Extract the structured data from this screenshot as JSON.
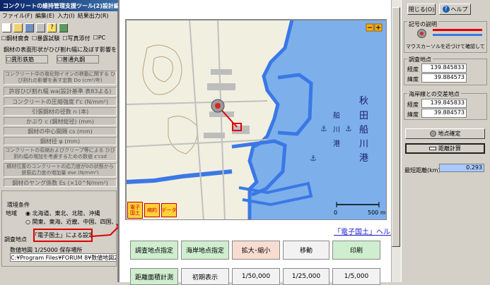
{
  "left": {
    "title": "コンクリートの維持管理支援ツール(2)設計編",
    "menu": [
      "ファイル(F)",
      "編集(E)",
      "入力(I)",
      "結果出力(R)"
    ],
    "toolbar_checks": [
      "鋼材腐食",
      "暴露試験",
      "写真添付",
      "PC"
    ],
    "section_header": "鋼材の表面形状がひび割れ幅に及ぼす影響を表す係数",
    "checks": [
      "異形鉄筋",
      "普通丸鋼"
    ],
    "calc_rows": [
      "コンクリート中の塩化物イオンの移動に関する\nひび割れの影響を表す定数 Do (cm²/年)",
      "許容ひび割れ幅 wa(設計基準 表83よる)",
      "コンクリートの圧縮強度 f'c (N/mm²)",
      "引張鋼材の径数 n (本)",
      "かぶり c (鋼材総径) (mm)",
      "鋼材の中心間隔 cs (mm)",
      "鋼材径 φ (mm)",
      "コンクリートの収縮およびクリープ等による\nひび割れ幅の増加を考慮するための数値 ε'csd",
      "鋼材位置のコンクリートの応力度が0の状態から\n鉄筋応力度の増加量 σse (N/mm²)",
      "鋼材のヤング係数 Es (×10^N/mm²)"
    ],
    "env_title": "環境条件",
    "region_label": "地域",
    "regions": [
      "北海道、東北、北陸、沖縄",
      "関東、東海、近畿、中国、四国、九州"
    ],
    "survey_label": "調査地点",
    "survey_button": "「電子国土」による設定",
    "map_label": "数値地図 1/25000 保存場所",
    "map_path": "C:¥Program Files¥FORUM 8¥数値地図25000"
  },
  "map_panel": {
    "sea_chars": [
      "秋",
      "田",
      "船",
      "川",
      "港"
    ],
    "port_chars": [
      "船",
      "川",
      "港"
    ],
    "buttons_top": [
      "電子国土",
      "縮約",
      "データ"
    ],
    "scale_start": "0",
    "scale_end": "500 m",
    "help_link": "「電子国土」ヘルプ",
    "button_row1": [
      "調査地点指定",
      "海岸地点指定",
      "拡大･縮小",
      "移動",
      "印刷"
    ],
    "button_row2": [
      "距離面積計測",
      "初期表示",
      "1/50,000",
      "1/25,000",
      "1/5,000"
    ]
  },
  "right": {
    "close_label": "閉じる(O)",
    "help_label": "ヘルプ",
    "legend_title": "記号の説明",
    "legend_note": "マウスカーソルを近づけて確認してください",
    "survey_title": "調査地点",
    "survey_lon_label": "経度",
    "survey_lon": "139.845833",
    "survey_lat_label": "緯度",
    "survey_lat": "39.884573",
    "coast_title": "海岸線との交差地点",
    "coast_lon_label": "経度",
    "coast_lon": "139.845833",
    "coast_lat_label": "緯度",
    "coast_lat": "39.884573",
    "confirm_label": "地点確定",
    "calc_label": "距離計算",
    "distance_label": "最短距離(km)",
    "distance_value": "0.293"
  },
  "colors": {
    "sea": "#7db0ea",
    "coast": "#3b78e6",
    "survey_btn_border": "#e00000",
    "arrow": "#e00000",
    "distance_bg": "#a8c8ff"
  }
}
